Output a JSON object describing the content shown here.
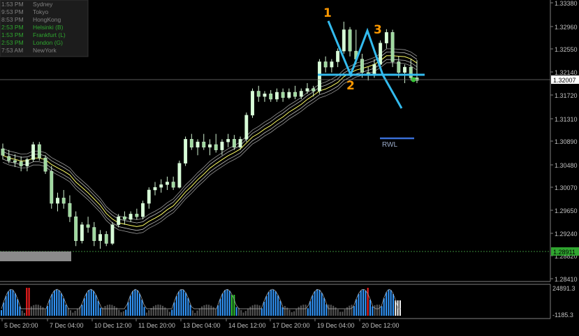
{
  "sessions": [
    {
      "time": "1:53 PM",
      "name": "Sydney",
      "color": "#808080"
    },
    {
      "time": "9:53 PM",
      "name": "Tokyo",
      "color": "#808080"
    },
    {
      "time": "8:53 PM",
      "name": "HongKong",
      "color": "#808080"
    },
    {
      "time": "2:53 PM",
      "name": "Helsinki  (B)",
      "color": "#2fa52f"
    },
    {
      "time": "1:53 PM",
      "name": "Frankfurt  (L)",
      "color": "#2fa52f"
    },
    {
      "time": "2:53 PM",
      "name": "London  (G)",
      "color": "#2fa52f"
    },
    {
      "time": "7:53 AM",
      "name": "NewYork",
      "color": "#808080"
    }
  ],
  "price_axis": {
    "ticks": [
      "1.33380",
      "1.32960",
      "1.32550",
      "1.32140",
      "1.31720",
      "1.31310",
      "1.30890",
      "1.30480",
      "1.30070",
      "1.29650",
      "1.29240",
      "1.28820",
      "1.28410"
    ],
    "current_price": "1.32007",
    "low_marker_price": "1.28911"
  },
  "time_axis": {
    "labels": [
      "5 Dec 20:00",
      "7 Dec 04:00",
      "10 Dec 12:00",
      "11 Dec 20:00",
      "13 Dec 04:00",
      "14 Dec 12:00",
      "17 Dec 20:00",
      "19 Dec 04:00",
      "20 Dec 12:00"
    ]
  },
  "indicator_axis": {
    "top": "24891.3",
    "bottom": "-1185.3"
  },
  "annotations": {
    "pattern_points": [
      "1",
      "2",
      "3"
    ],
    "rwl_label": "RWL"
  },
  "colors": {
    "up_candle": "#b4f0b4",
    "down_candle": "#b4f0b4",
    "band": "#c8c8c8",
    "midline": "#ffff66",
    "pattern": "#33bbee",
    "numbers": "#ff9900",
    "hist_blue": "#3399ff",
    "hist_red": "#ff2020",
    "hist_green": "#33cc33",
    "hist_gray": "#555555"
  },
  "chart_data": {
    "type": "candlestick",
    "symbol_scale": {
      "ylim": [
        1.2825,
        1.3348
      ]
    },
    "series": [
      {
        "name": "price",
        "ohlc": [
          [
            1.3072,
            1.3082,
            1.3052,
            1.306
          ],
          [
            1.3058,
            1.307,
            1.3045,
            1.305
          ],
          [
            1.305,
            1.3062,
            1.3038,
            1.3047
          ],
          [
            1.3048,
            1.3058,
            1.303,
            1.304
          ],
          [
            1.304,
            1.3055,
            1.303,
            1.3052
          ],
          [
            1.3052,
            1.3085,
            1.3048,
            1.308
          ],
          [
            1.308,
            1.3085,
            1.305,
            1.3055
          ],
          [
            1.3055,
            1.306,
            1.3025,
            1.303
          ],
          [
            1.303,
            1.304,
            1.296,
            1.297
          ],
          [
            1.297,
            1.299,
            1.2955,
            1.298
          ],
          [
            1.298,
            1.2995,
            1.296,
            1.297
          ],
          [
            1.297,
            1.2985,
            1.2935,
            1.2945
          ],
          [
            1.2945,
            1.2955,
            1.289,
            1.29
          ],
          [
            1.29,
            1.2935,
            1.2895,
            1.293
          ],
          [
            1.293,
            1.2945,
            1.2915,
            1.2925
          ],
          [
            1.2925,
            1.2935,
            1.289,
            1.29
          ],
          [
            1.29,
            1.292,
            1.2885,
            1.2912
          ],
          [
            1.2912,
            1.2918,
            1.289,
            1.2895
          ],
          [
            1.2895,
            1.2935,
            1.2892,
            1.293
          ],
          [
            1.293,
            1.295,
            1.2925,
            1.2945
          ],
          [
            1.2945,
            1.2955,
            1.293,
            1.294
          ],
          [
            1.294,
            1.2955,
            1.2935,
            1.295
          ],
          [
            1.295,
            1.296,
            1.294,
            1.2945
          ],
          [
            1.2945,
            1.2975,
            1.294,
            1.297
          ],
          [
            1.297,
            1.3,
            1.296,
            1.2995
          ],
          [
            1.2995,
            1.301,
            1.2985,
            1.3
          ],
          [
            1.3,
            1.3015,
            1.299,
            1.3005
          ],
          [
            1.3005,
            1.302,
            1.2995,
            1.301
          ],
          [
            1.301,
            1.302,
            1.2995,
            1.3
          ],
          [
            1.3,
            1.305,
            1.2998,
            1.3045
          ],
          [
            1.3045,
            1.3095,
            1.304,
            1.309
          ],
          [
            1.309,
            1.31,
            1.307,
            1.3075
          ],
          [
            1.3075,
            1.309,
            1.306,
            1.3085
          ],
          [
            1.3085,
            1.31,
            1.307,
            1.3075
          ],
          [
            1.3075,
            1.309,
            1.306,
            1.308
          ],
          [
            1.308,
            1.31,
            1.3065,
            1.307
          ],
          [
            1.307,
            1.309,
            1.306,
            1.3085
          ],
          [
            1.3085,
            1.31,
            1.3075,
            1.309
          ],
          [
            1.309,
            1.3098,
            1.307,
            1.3075
          ],
          [
            1.3075,
            1.3095,
            1.307,
            1.309
          ],
          [
            1.309,
            1.314,
            1.3085,
            1.3135
          ],
          [
            1.3135,
            1.3185,
            1.313,
            1.318
          ],
          [
            1.318,
            1.319,
            1.316,
            1.317
          ],
          [
            1.317,
            1.318,
            1.316,
            1.3175
          ],
          [
            1.3175,
            1.3182,
            1.316,
            1.3165
          ],
          [
            1.3165,
            1.3185,
            1.316,
            1.3178
          ],
          [
            1.3178,
            1.3185,
            1.316,
            1.3168
          ],
          [
            1.3168,
            1.3185,
            1.3165,
            1.3178
          ],
          [
            1.3178,
            1.319,
            1.3165,
            1.317
          ],
          [
            1.317,
            1.3185,
            1.3165,
            1.318
          ],
          [
            1.318,
            1.3195,
            1.3175,
            1.3185
          ],
          [
            1.3185,
            1.319,
            1.317,
            1.318
          ],
          [
            1.318,
            1.324,
            1.3175,
            1.3235
          ],
          [
            1.3235,
            1.3245,
            1.3215,
            1.3225
          ],
          [
            1.3225,
            1.324,
            1.3215,
            1.3235
          ],
          [
            1.3235,
            1.326,
            1.3225,
            1.3255
          ],
          [
            1.3255,
            1.331,
            1.325,
            1.3295
          ],
          [
            1.3295,
            1.33,
            1.3245,
            1.3255
          ],
          [
            1.3255,
            1.3295,
            1.323,
            1.324
          ],
          [
            1.324,
            1.325,
            1.3205,
            1.3215
          ],
          [
            1.3215,
            1.3225,
            1.32,
            1.321
          ],
          [
            1.321,
            1.324,
            1.3205,
            1.323
          ],
          [
            1.323,
            1.3275,
            1.322,
            1.327
          ],
          [
            1.327,
            1.3296,
            1.326,
            1.329
          ],
          [
            1.329,
            1.3295,
            1.3225,
            1.3235
          ],
          [
            1.3235,
            1.3245,
            1.3205,
            1.3215
          ],
          [
            1.3215,
            1.323,
            1.3195,
            1.3225
          ],
          [
            1.3225,
            1.324,
            1.32,
            1.3205
          ],
          [
            1.3205,
            1.3238,
            1.3195,
            1.32
          ]
        ]
      }
    ]
  }
}
